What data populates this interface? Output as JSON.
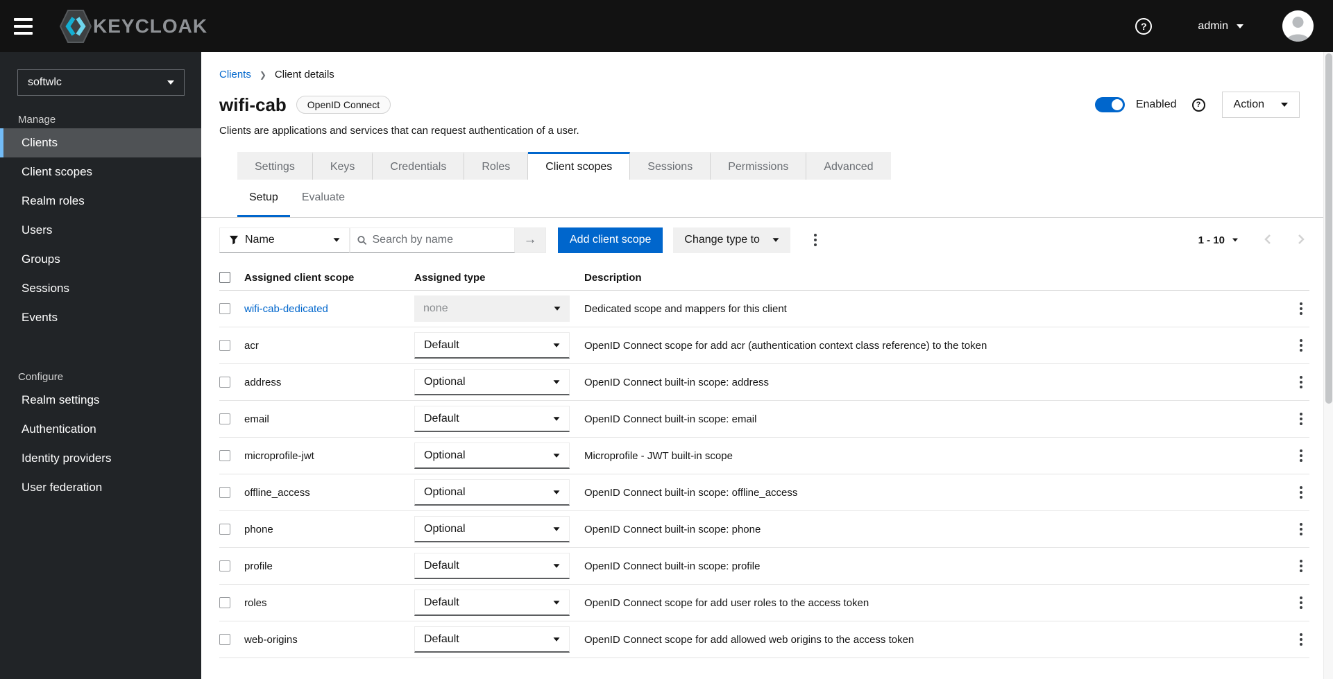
{
  "colors": {
    "accent": "#0066cc",
    "masthead_bg": "#121212",
    "sidebar_bg": "#212427",
    "sidebar_active_border": "#73bcf7",
    "link": "#0066cc"
  },
  "masthead": {
    "brand": "KEYCLOAK",
    "help": "?",
    "user": "admin"
  },
  "sidebar": {
    "realm": "softwlc",
    "sections": [
      {
        "label": "Manage",
        "items": [
          {
            "label": "Clients",
            "active": true
          },
          {
            "label": "Client scopes",
            "active": false
          },
          {
            "label": "Realm roles",
            "active": false
          },
          {
            "label": "Users",
            "active": false
          },
          {
            "label": "Groups",
            "active": false
          },
          {
            "label": "Sessions",
            "active": false
          },
          {
            "label": "Events",
            "active": false
          }
        ]
      },
      {
        "label": "Configure",
        "items": [
          {
            "label": "Realm settings",
            "active": false
          },
          {
            "label": "Authentication",
            "active": false
          },
          {
            "label": "Identity providers",
            "active": false
          },
          {
            "label": "User federation",
            "active": false
          }
        ]
      }
    ]
  },
  "breadcrumb": {
    "link": "Clients",
    "current": "Client details"
  },
  "page": {
    "title": "wifi-cab",
    "badge": "OpenID Connect",
    "subtitle": "Clients are applications and services that can request authentication of a user.",
    "enabled_label": "Enabled",
    "help": "?",
    "action_label": "Action"
  },
  "tabs": [
    {
      "label": "Settings",
      "active": false
    },
    {
      "label": "Keys",
      "active": false
    },
    {
      "label": "Credentials",
      "active": false
    },
    {
      "label": "Roles",
      "active": false
    },
    {
      "label": "Client scopes",
      "active": true
    },
    {
      "label": "Sessions",
      "active": false
    },
    {
      "label": "Permissions",
      "active": false
    },
    {
      "label": "Advanced",
      "active": false
    }
  ],
  "subtabs": [
    {
      "label": "Setup",
      "active": true
    },
    {
      "label": "Evaluate",
      "active": false
    }
  ],
  "toolbar": {
    "filter_label": "Name",
    "search_placeholder": "Search by name",
    "search_value": "",
    "add_button": "Add client scope",
    "change_type_button": "Change type to",
    "pagination_range": "1 - 10"
  },
  "table": {
    "columns": [
      "Assigned client scope",
      "Assigned type",
      "Description"
    ],
    "rows": [
      {
        "name": "wifi-cab-dedicated",
        "is_link": true,
        "type": "none",
        "type_disabled": true,
        "description": "Dedicated scope and mappers for this client"
      },
      {
        "name": "acr",
        "is_link": false,
        "type": "Default",
        "type_disabled": false,
        "description": "OpenID Connect scope for add acr (authentication context class reference) to the token"
      },
      {
        "name": "address",
        "is_link": false,
        "type": "Optional",
        "type_disabled": false,
        "description": "OpenID Connect built-in scope: address"
      },
      {
        "name": "email",
        "is_link": false,
        "type": "Default",
        "type_disabled": false,
        "description": "OpenID Connect built-in scope: email"
      },
      {
        "name": "microprofile-jwt",
        "is_link": false,
        "type": "Optional",
        "type_disabled": false,
        "description": "Microprofile - JWT built-in scope"
      },
      {
        "name": "offline_access",
        "is_link": false,
        "type": "Optional",
        "type_disabled": false,
        "description": "OpenID Connect built-in scope: offline_access"
      },
      {
        "name": "phone",
        "is_link": false,
        "type": "Optional",
        "type_disabled": false,
        "description": "OpenID Connect built-in scope: phone"
      },
      {
        "name": "profile",
        "is_link": false,
        "type": "Default",
        "type_disabled": false,
        "description": "OpenID Connect built-in scope: profile"
      },
      {
        "name": "roles",
        "is_link": false,
        "type": "Default",
        "type_disabled": false,
        "description": "OpenID Connect scope for add user roles to the access token"
      },
      {
        "name": "web-origins",
        "is_link": false,
        "type": "Default",
        "type_disabled": false,
        "description": "OpenID Connect scope for add allowed web origins to the access token"
      }
    ]
  }
}
